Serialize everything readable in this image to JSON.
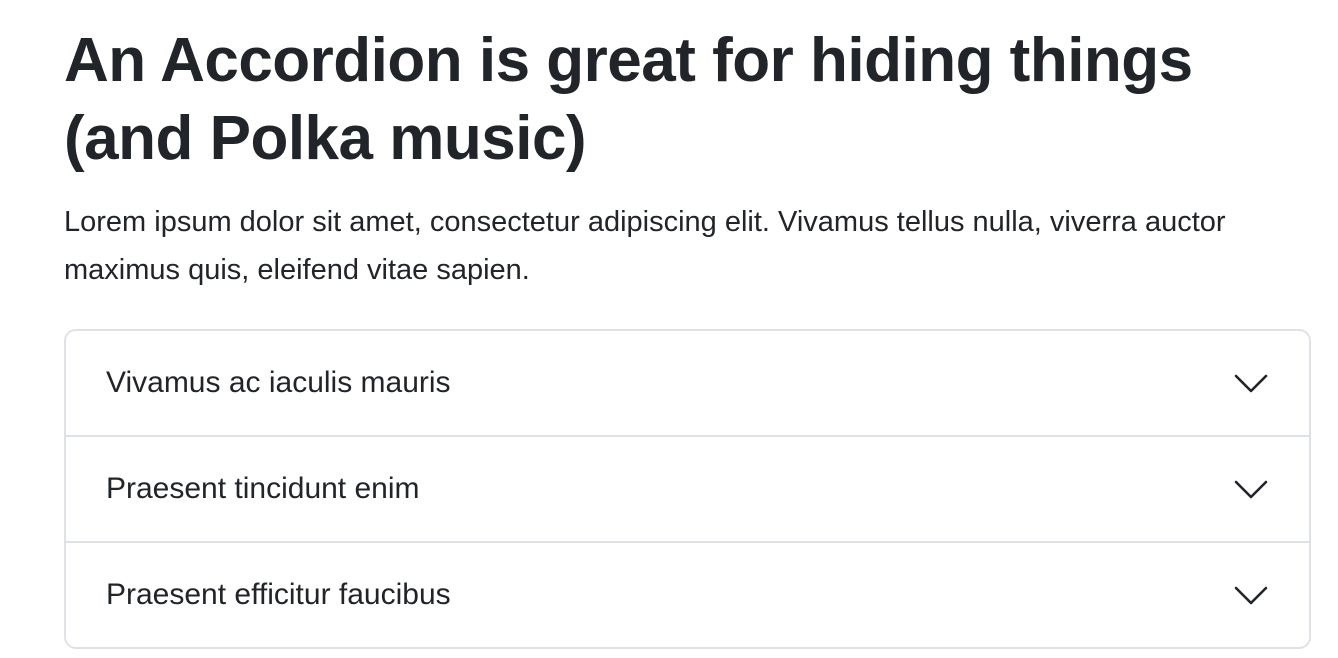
{
  "page": {
    "title": "An Accordion is great for hiding things (and Polka music)",
    "intro": "Lorem ipsum dolor sit amet, consectetur adipiscing elit. Vivamus tellus nulla, viverra auctor maximus quis, eleifend vitae sapien."
  },
  "accordion": {
    "items": [
      {
        "label": "Vivamus ac iaculis mauris",
        "icon": "chevron-down-icon",
        "expanded": false
      },
      {
        "label": "Praesent tincidunt enim",
        "icon": "chevron-down-icon",
        "expanded": false
      },
      {
        "label": "Praesent efficitur faucibus",
        "icon": "chevron-down-icon",
        "expanded": false
      }
    ]
  },
  "colors": {
    "text": "#212529",
    "border": "#dee2e6",
    "background": "#ffffff"
  }
}
